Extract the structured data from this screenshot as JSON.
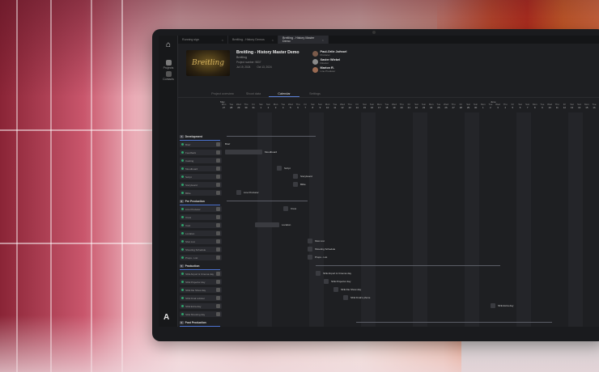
{
  "tabs": [
    {
      "label": "Running sign",
      "active": false
    },
    {
      "label": "Breitling - History Demos",
      "active": false
    },
    {
      "label": "Breitling - History Master Demo",
      "active": true
    }
  ],
  "rail": {
    "projects_label": "Projects",
    "contacts_label": "Contacts"
  },
  "project": {
    "thumb_text": "Breitling",
    "title": "Breitling - History Master Demo",
    "client": "Breitling",
    "project_number": "Project number: 9837",
    "start_date": "Jul 19, 2024",
    "end_date": "Oct 13, 2024"
  },
  "people": [
    {
      "name": "Paul-Orile Joëssel",
      "role": "Producer"
    },
    {
      "name": "Xavier Wiebel",
      "role": "Director"
    },
    {
      "name": "Marion R.",
      "role": "Line Producer"
    }
  ],
  "view_tabs": [
    {
      "label": "Project overview",
      "active": false
    },
    {
      "label": "Shoot data",
      "active": false
    },
    {
      "label": "Calendar",
      "active": true
    },
    {
      "label": "Settings",
      "active": false
    }
  ],
  "months": [
    "May",
    "June"
  ],
  "days": [
    [
      "Mon",
      "27"
    ],
    [
      "Tue",
      "28"
    ],
    [
      "Wed",
      "29"
    ],
    [
      "Thu",
      "30"
    ],
    [
      "Fri",
      "31"
    ],
    [
      "Sat",
      "1"
    ],
    [
      "Sun",
      "2"
    ],
    [
      "Mon",
      "3"
    ],
    [
      "Tue",
      "4"
    ],
    [
      "Wed",
      "5"
    ],
    [
      "Thu",
      "6"
    ],
    [
      "Fri",
      "7"
    ],
    [
      "Sat",
      "8"
    ],
    [
      "Sun",
      "9"
    ],
    [
      "Mon",
      "10"
    ],
    [
      "Tue",
      "11"
    ],
    [
      "Wed",
      "12"
    ],
    [
      "Thu",
      "13"
    ],
    [
      "Fri",
      "14"
    ],
    [
      "Sat",
      "15"
    ],
    [
      "Sun",
      "16"
    ],
    [
      "Mon",
      "17"
    ],
    [
      "Tue",
      "18"
    ],
    [
      "Wed",
      "19"
    ],
    [
      "Thu",
      "20"
    ],
    [
      "Fri",
      "21"
    ],
    [
      "Sat",
      "22"
    ],
    [
      "Sun",
      "23"
    ],
    [
      "Mon",
      "24"
    ],
    [
      "Tue",
      "25"
    ],
    [
      "Wed",
      "26"
    ],
    [
      "Thu",
      "27"
    ],
    [
      "Fri",
      "28"
    ],
    [
      "Sat",
      "29"
    ],
    [
      "Sun",
      "30"
    ],
    [
      "Mon",
      "1"
    ],
    [
      "Tue",
      "2"
    ],
    [
      "Wed",
      "3"
    ],
    [
      "Thu",
      "4"
    ],
    [
      "Fri",
      "5"
    ],
    [
      "Sat",
      "6"
    ],
    [
      "Sun",
      "7"
    ],
    [
      "Mon",
      "8"
    ],
    [
      "Tue",
      "9"
    ],
    [
      "Wed",
      "10"
    ],
    [
      "Thu",
      "11"
    ],
    [
      "Fri",
      "12"
    ],
    [
      "Sat",
      "13"
    ],
    [
      "Sun",
      "14"
    ],
    [
      "Mon",
      "15"
    ],
    [
      "Tue",
      "16"
    ],
    [
      "Wed",
      "17"
    ],
    [
      "Thu",
      "18"
    ],
    [
      "Fri",
      "19"
    ],
    [
      "Sat",
      "20"
    ],
    [
      "Sun",
      "21"
    ]
  ],
  "sections": [
    {
      "name": "Development",
      "count": "7"
    },
    {
      "name": "Pre Production",
      "count": "6"
    },
    {
      "name": "Production",
      "count": "5"
    },
    {
      "name": "Post Production",
      "count": "5"
    }
  ],
  "rows": [
    "Brief",
    "Feedback",
    "Casting",
    "Moodboard",
    "Script",
    "Storyboard",
    "Bible",
    "Line Producer",
    "Crew",
    "Cast",
    "Location",
    "Shot List",
    "Shooting Schedule",
    "SFE Airport & Cinema day",
    "SFE Projector day",
    "SFE Die Show day",
    "SFE Final Lobster",
    "SFE Extra day",
    "SFE Shooting day",
    "First Rough Cut",
    "Marine Design",
    "Final Correction"
  ],
  "tasks": [
    {
      "label": "Brief"
    },
    {
      "label": "Moodboard"
    },
    {
      "label": "Script"
    },
    {
      "label": "Storyboard"
    },
    {
      "label": "Bible"
    },
    {
      "label": "Line Producer"
    },
    {
      "label": "Crew"
    },
    {
      "label": "Location"
    },
    {
      "label": "Shot List"
    },
    {
      "label": "Shooting Schedule"
    },
    {
      "label": "Props - List"
    },
    {
      "label": "SFE Airport & Cinema day"
    },
    {
      "label": "SFE Projector day"
    },
    {
      "label": "SFE Die Show day"
    },
    {
      "label": "SFE Final's phone"
    },
    {
      "label": "SFE Extra day"
    },
    {
      "label": "First Rough Cut"
    },
    {
      "label": "Marine Design"
    },
    {
      "label": "Final Correction"
    }
  ]
}
